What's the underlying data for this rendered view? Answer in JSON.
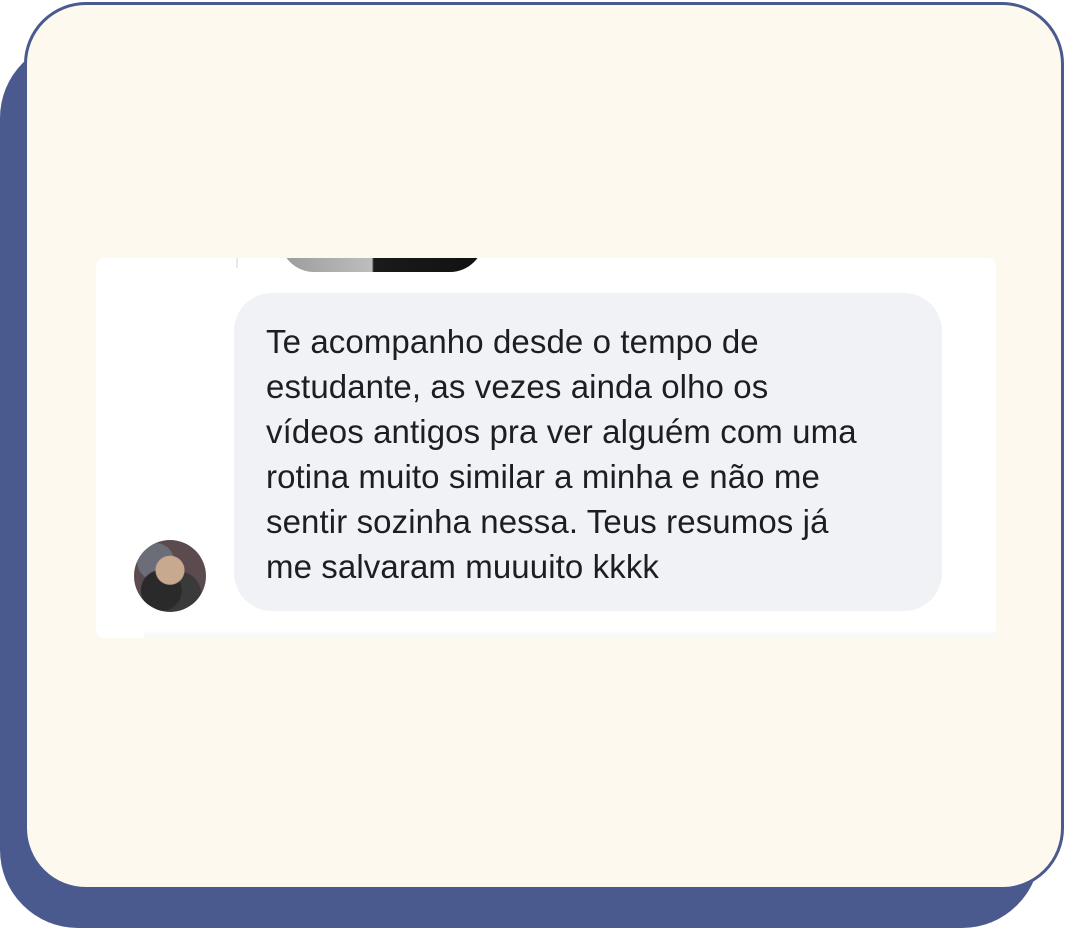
{
  "comment": {
    "text": "Te acompanho desde o tempo de estudante, as vezes ainda olho os vídeos antigos pra ver alguém com uma rotina muito similar a minha e não me sentir sozinha nessa. Teus resumos já me salvaram muuuito kkkk",
    "lines": [
      "Te acompanho desde o tempo de",
      "estudante, as vezes ainda olho os",
      "vídeos antigos pra ver alguém com uma",
      "rotina muito similar a minha e não me",
      "sentir sozinha nessa. Teus resumos já",
      "me salvaram muuuito kkkk"
    ]
  },
  "colors": {
    "card_background": "#fdf9ee",
    "card_border": "#4a5a8e",
    "bubble_background": "#f0f2f5",
    "text": "#1c1e21"
  }
}
